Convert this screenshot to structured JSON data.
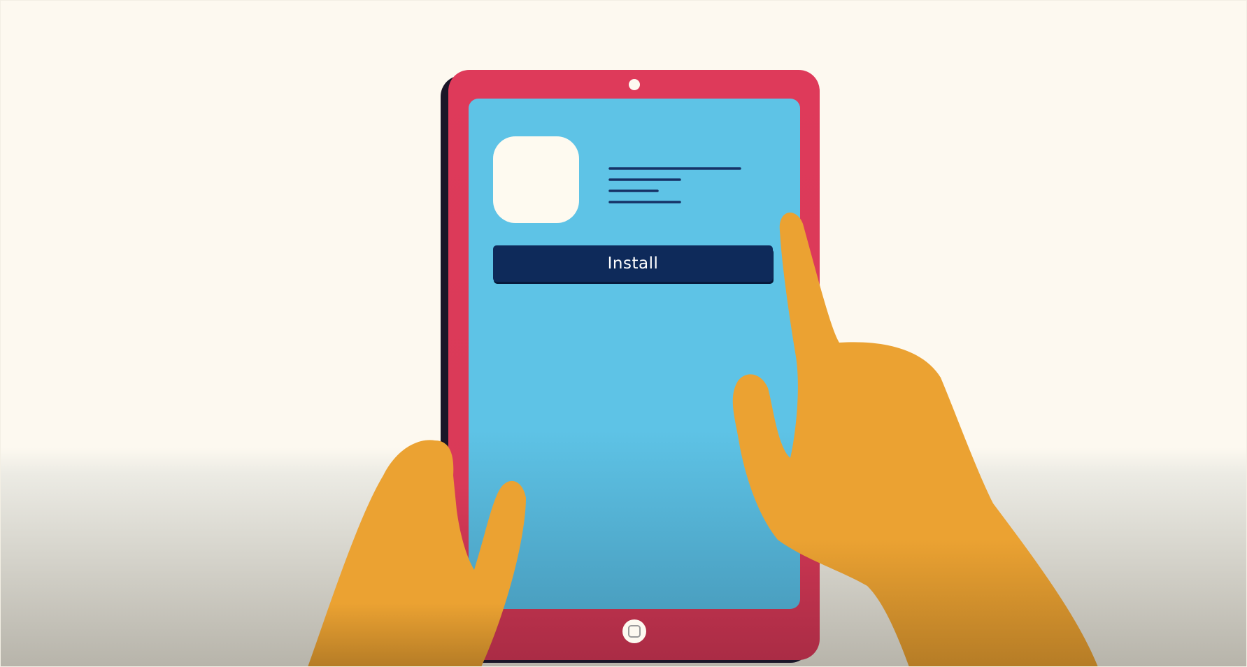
{
  "install_button": {
    "label": "Install"
  },
  "colors": {
    "background": "#fdf9f0",
    "floor_shadow": "#c9c6bd",
    "tablet_body": "#d93a58",
    "tablet_shadow": "#1a1628",
    "screen": "#5ec3e6",
    "screen_dark": "#4fa6c6",
    "app_icon": "#fefaf0",
    "text_lines": "#163266",
    "button": "#0e2a5a",
    "hand": "#eba232",
    "hand_shade": "#b97f27"
  },
  "icons": {
    "camera": "camera-dot-icon",
    "home": "home-button-icon",
    "app": "app-icon-placeholder"
  }
}
